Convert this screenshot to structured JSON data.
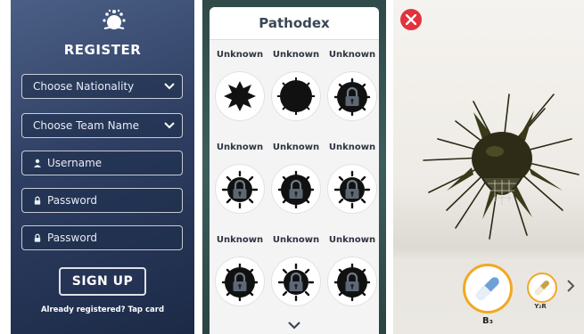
{
  "register": {
    "title": "REGISTER",
    "nationality": {
      "placeholder": "Choose Nationality"
    },
    "team": {
      "placeholder": "Choose Team Name"
    },
    "username": {
      "placeholder": "Username"
    },
    "password1": {
      "placeholder": "Password"
    },
    "password2": {
      "placeholder": "Password"
    },
    "signup_label": "SIGN UP",
    "already_label": "Already registered? Tap card"
  },
  "pathodex": {
    "title": "Pathodex",
    "entries": [
      {
        "label": "Unknown",
        "icon": "virus-silhouette-icon"
      },
      {
        "label": "Unknown",
        "icon": "virus-silhouette-icon"
      },
      {
        "label": "Unknown",
        "icon": "locked-virus-icon"
      },
      {
        "label": "Unknown",
        "icon": "locked-virus-icon"
      },
      {
        "label": "Unknown",
        "icon": "locked-virus-icon"
      },
      {
        "label": "Unknown",
        "icon": "locked-virus-icon"
      },
      {
        "label": "Unknown",
        "icon": "locked-virus-icon"
      },
      {
        "label": "Unknown",
        "icon": "locked-virus-icon"
      },
      {
        "label": "Unknown",
        "icon": "locked-virus-icon"
      }
    ]
  },
  "ar_view": {
    "weapons": [
      {
        "label": "B₃",
        "icon": "pill-wand-icon",
        "selected": true
      },
      {
        "label": "Y₂R",
        "icon": "pill-wand-icon",
        "selected": false
      }
    ]
  },
  "colors": {
    "accent_orange": "#f2a823",
    "close_red": "#e2323d",
    "register_bg": "#2f3f63",
    "pathodex_bg": "#2f4a48"
  }
}
